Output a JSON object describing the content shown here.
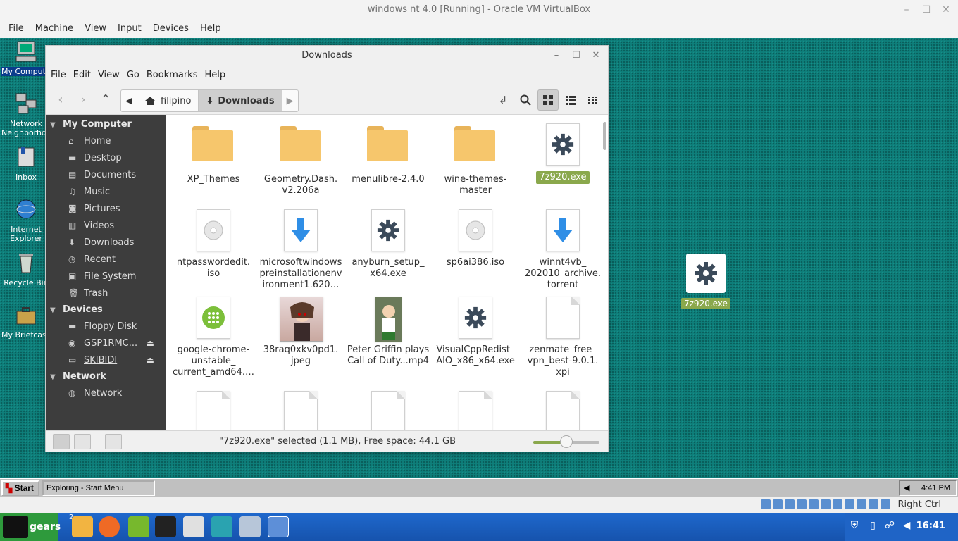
{
  "host": {
    "window_title": "windows nt 4.0 [Running] - Oracle VM VirtualBox",
    "menu": [
      "File",
      "Machine",
      "View",
      "Input",
      "Devices",
      "Help"
    ],
    "status_right": "Right Ctrl"
  },
  "desktop_icons": [
    {
      "label": "My Computer",
      "icon": "my-computer-icon"
    },
    {
      "label": "Network Neighborhood",
      "icon": "network-neighborhood-icon"
    },
    {
      "label": "Inbox",
      "icon": "inbox-icon"
    },
    {
      "label": "Internet Explorer",
      "icon": "internet-explorer-icon"
    },
    {
      "label": "Recycle Bin",
      "icon": "recycle-bin-icon"
    },
    {
      "label": "My Briefcase",
      "icon": "briefcase-icon"
    }
  ],
  "nemo": {
    "title": "Downloads",
    "menu": [
      "File",
      "Edit",
      "View",
      "Go",
      "Bookmarks",
      "Help"
    ],
    "path": [
      "filipino",
      "Downloads"
    ],
    "sidebar": {
      "sections": [
        {
          "title": "My Computer",
          "items": [
            "Home",
            "Desktop",
            "Documents",
            "Music",
            "Pictures",
            "Videos",
            "Downloads",
            "Recent",
            "File System",
            "Trash"
          ]
        },
        {
          "title": "Devices",
          "items": [
            "Floppy Disk",
            "GSP1RMC...",
            "SKIBIDI"
          ]
        },
        {
          "title": "Network",
          "items": [
            "Network"
          ]
        }
      ]
    },
    "files": [
      {
        "name": "XP_Themes",
        "type": "folder"
      },
      {
        "name": "Geometry.Dash.\nv2.206a",
        "type": "folder"
      },
      {
        "name": "menulibre-2.4.0",
        "type": "folder"
      },
      {
        "name": "wine-themes-\nmaster",
        "type": "folder"
      },
      {
        "name": "7z920.exe",
        "type": "exe",
        "selected": true
      },
      {
        "name": "ntpasswordedit.\niso",
        "type": "iso"
      },
      {
        "name": "microsoftwindows\npreinstallationenv\nironment1.620…",
        "type": "download"
      },
      {
        "name": "anyburn_setup_\nx64.exe",
        "type": "exe"
      },
      {
        "name": "sp6ai386.iso",
        "type": "iso"
      },
      {
        "name": "winnt4vb_\n202010_archive.\ntorrent",
        "type": "download"
      },
      {
        "name": "google-chrome-\nunstable_\ncurrent_amd64.…",
        "type": "deb"
      },
      {
        "name": "38raq0xkv0pd1.\njpeg",
        "type": "image"
      },
      {
        "name": "Peter Griffin plays\nCall of Duty...mp4",
        "type": "video"
      },
      {
        "name": "VisualCppRedist_\nAIO_x86_x64.exe",
        "type": "exe"
      },
      {
        "name": "zenmate_free_\nvpn_best-9.0.1.\nxpi",
        "type": "blank"
      }
    ],
    "status": "\"7z920.exe\" selected (1.1 MB), Free space: 44.1 GB",
    "zoom_level": 0.5
  },
  "drag": {
    "label": "7z920.exe"
  },
  "nt_taskbar": {
    "start": "Start",
    "task": "Exploring - Start Menu",
    "clock": "4:41 PM"
  },
  "panel": {
    "menu_label": "gears",
    "badge": "2",
    "clock": "16:41"
  },
  "colors": {
    "selection": "#8aa84c",
    "desktop": "#0f7f7b",
    "sidebar": "#3d3d3d",
    "panel": "#1a5fbf"
  }
}
